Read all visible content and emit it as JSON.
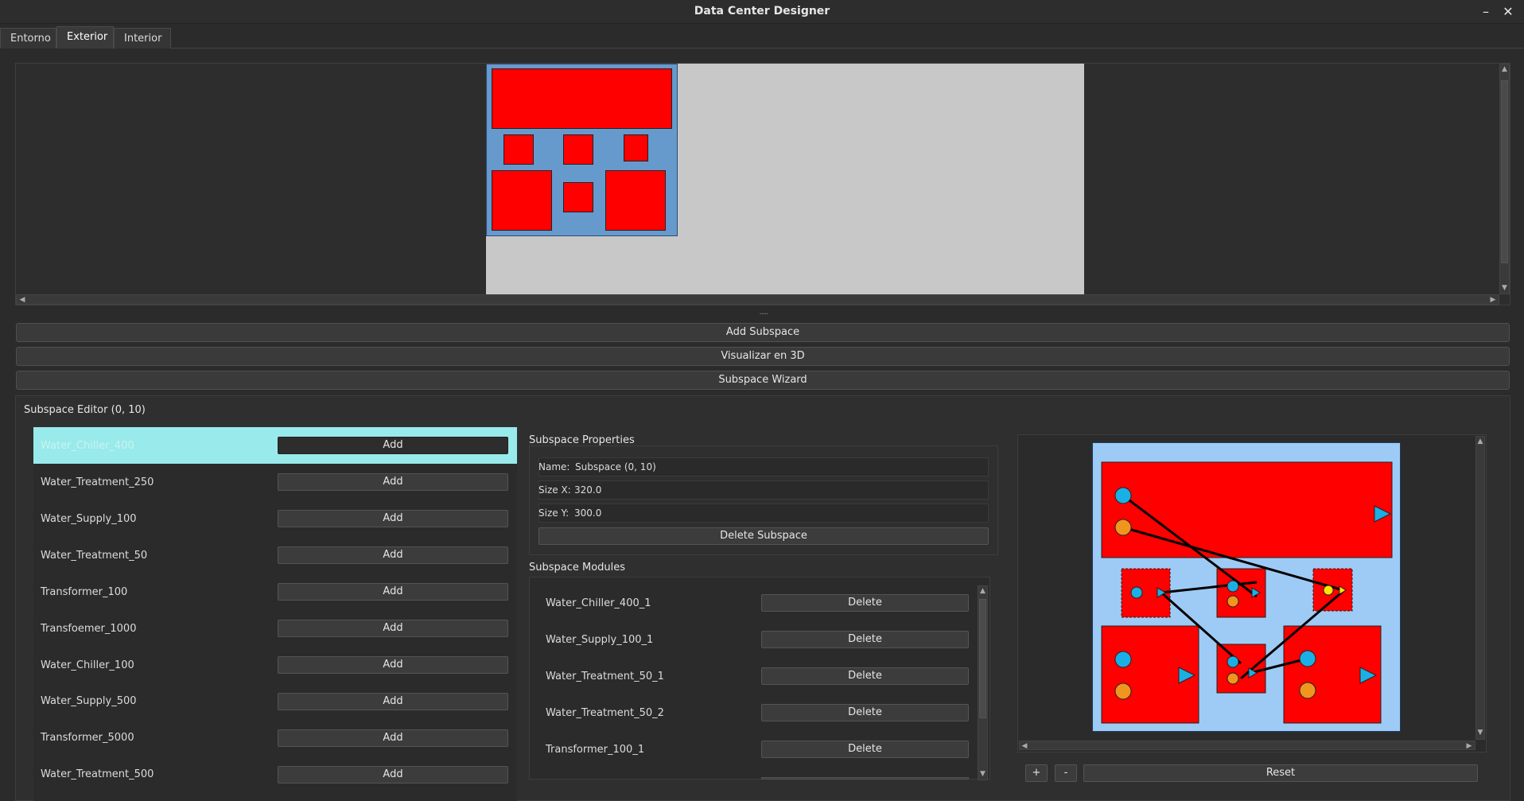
{
  "window": {
    "title": "Data Center Designer",
    "minimize_icon": "minimize-icon",
    "close_icon": "close-icon"
  },
  "tabs": [
    {
      "label": "Entorno",
      "active": false
    },
    {
      "label": "Exterior",
      "active": true
    },
    {
      "label": "Interior",
      "active": false
    }
  ],
  "splitter_handle": ".....",
  "actions": {
    "add_subspace": "Add Subspace",
    "visualize_3d": "Visualizar en 3D",
    "subspace_wizard": "Subspace Wizard"
  },
  "editor": {
    "title": "Subspace Editor (0, 10)",
    "available_modules": [
      {
        "name": "Water_Chiller_400",
        "button": "Add",
        "selected": true
      },
      {
        "name": "Water_Treatment_250",
        "button": "Add"
      },
      {
        "name": "Water_Supply_100",
        "button": "Add"
      },
      {
        "name": "Water_Treatment_50",
        "button": "Add"
      },
      {
        "name": "Transformer_100",
        "button": "Add"
      },
      {
        "name": "Transfoemer_1000",
        "button": "Add"
      },
      {
        "name": "Water_Chiller_100",
        "button": "Add"
      },
      {
        "name": "Water_Supply_500",
        "button": "Add"
      },
      {
        "name": "Transformer_5000",
        "button": "Add"
      },
      {
        "name": "Water_Treatment_500",
        "button": "Add"
      }
    ],
    "properties": {
      "heading": "Subspace Properties",
      "name_label": "Name:",
      "name_value": "Subspace (0, 10)",
      "size_x_label": "Size X:",
      "size_x_value": "320.0",
      "size_y_label": "Size Y:",
      "size_y_value": "300.0",
      "delete_button": "Delete Subspace"
    },
    "modules": {
      "heading": "Subspace Modules",
      "items": [
        {
          "name": "Water_Chiller_400_1",
          "button": "Delete"
        },
        {
          "name": "Water_Supply_100_1",
          "button": "Delete"
        },
        {
          "name": "Water_Treatment_50_1",
          "button": "Delete"
        },
        {
          "name": "Water_Treatment_50_2",
          "button": "Delete"
        },
        {
          "name": "Transformer_100_1",
          "button": "Delete"
        }
      ]
    },
    "zoom": {
      "zoom_in": "+",
      "zoom_out": "-",
      "reset": "Reset"
    }
  },
  "colors": {
    "module_fill": "#ff0000",
    "subspace_fill": "#6699cc",
    "preview_bg": "#9ecbf5",
    "canvas_bg": "#c8c8c8",
    "selection": "#99eaea",
    "port_cyan": "#1ab0e6",
    "port_orange": "#f0961e",
    "port_yellow": "#ffe600"
  }
}
